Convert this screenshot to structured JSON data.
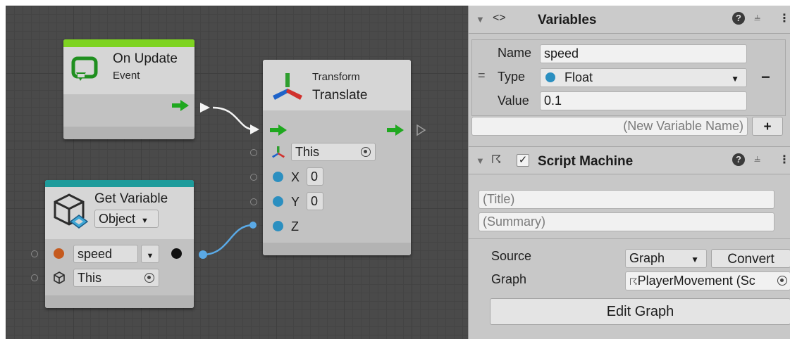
{
  "graph": {
    "on_update": {
      "title": "On Update",
      "subtitle": "Event",
      "accent": "#7ed321"
    },
    "translate": {
      "category": "Transform",
      "title": "Translate",
      "target": "This",
      "x_label": "X",
      "x_value": "0",
      "y_label": "Y",
      "y_value": "0",
      "z_label": "Z"
    },
    "get_variable": {
      "title": "Get Variable",
      "kind": "Object",
      "name_value": "speed",
      "target": "This",
      "accent": "#1e9b9b"
    }
  },
  "inspector": {
    "variables": {
      "title": "Variables",
      "name_label": "Name",
      "name_value": "speed",
      "type_label": "Type",
      "type_value": "Float",
      "value_label": "Value",
      "value_value": "0.1",
      "new_placeholder": "(New Variable Name)",
      "add_label": "+",
      "remove_label": "−"
    },
    "script_machine": {
      "title": "Script Machine",
      "title_placeholder": "(Title)",
      "summary_placeholder": "(Summary)",
      "source_label": "Source",
      "source_value": "Graph",
      "convert_label": "Convert",
      "graph_label": "Graph",
      "graph_value": "PlayerMovement (Sc",
      "edit_graph_label": "Edit Graph"
    }
  }
}
